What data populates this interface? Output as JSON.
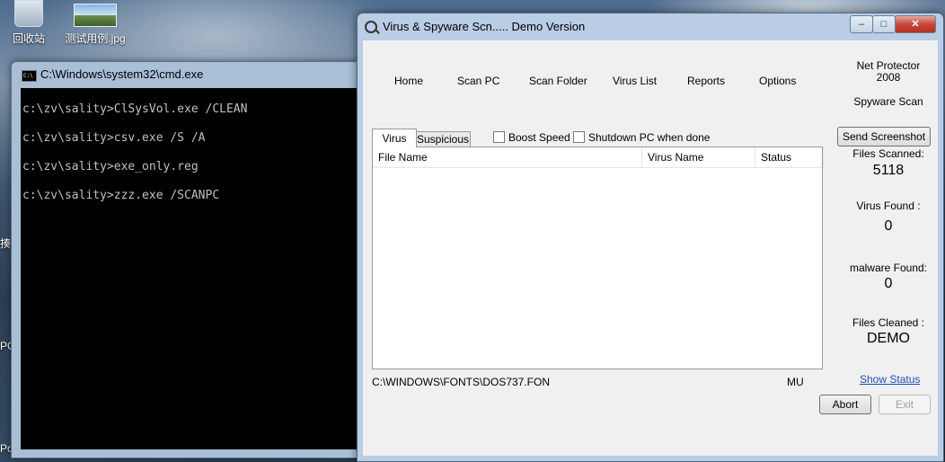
{
  "desktop": {
    "icons": [
      {
        "label": "回收站"
      },
      {
        "label": "测试用例.jpg"
      }
    ],
    "edge_fragments": [
      "揍",
      "PC",
      "Pov"
    ]
  },
  "cmd": {
    "title": "C:\\Windows\\system32\\cmd.exe",
    "icon_text": "C:\\",
    "lines": [
      "c:\\zv\\sality>ClSysVol.exe /CLEAN",
      "c:\\zv\\sality>csv.exe /S /A",
      "c:\\zv\\sality>exe_only.reg",
      "c:\\zv\\sality>zzz.exe /SCANPC"
    ]
  },
  "app": {
    "title": "Virus & Spyware Scn.....  Demo Version",
    "window_controls": {
      "minimize": "–",
      "maximize": "□",
      "close": "✕"
    },
    "nav": [
      "Home",
      "Scan PC",
      "Scan Folder",
      "Virus List",
      "Reports",
      "Options"
    ],
    "brand_line1": "Net Protector",
    "brand_line2": "2008",
    "brand_sub": "Spyware Scan",
    "tabs": [
      "Virus",
      "Suspicious"
    ],
    "active_tab": "Virus",
    "options": {
      "boost_speed": "Boost Speed",
      "shutdown": "Shutdown PC when done"
    },
    "columns": [
      "File Name",
      "Virus Name",
      "Status"
    ],
    "current_path": "C:\\WINDOWS\\FONTS\\DOS737.FON",
    "mode": "MU",
    "send_screenshot": "Send Screenshot",
    "stats": {
      "files_scanned_label": "Files Scanned:",
      "files_scanned_value": "5118",
      "virus_found_label": "Virus Found :",
      "virus_found_value": "0",
      "malware_found_label": "malware Found:",
      "malware_found_value": "0",
      "files_cleaned_label": "Files Cleaned :",
      "files_cleaned_value": "DEMO"
    },
    "show_status": "Show Status",
    "abort": "Abort",
    "exit": "Exit"
  }
}
